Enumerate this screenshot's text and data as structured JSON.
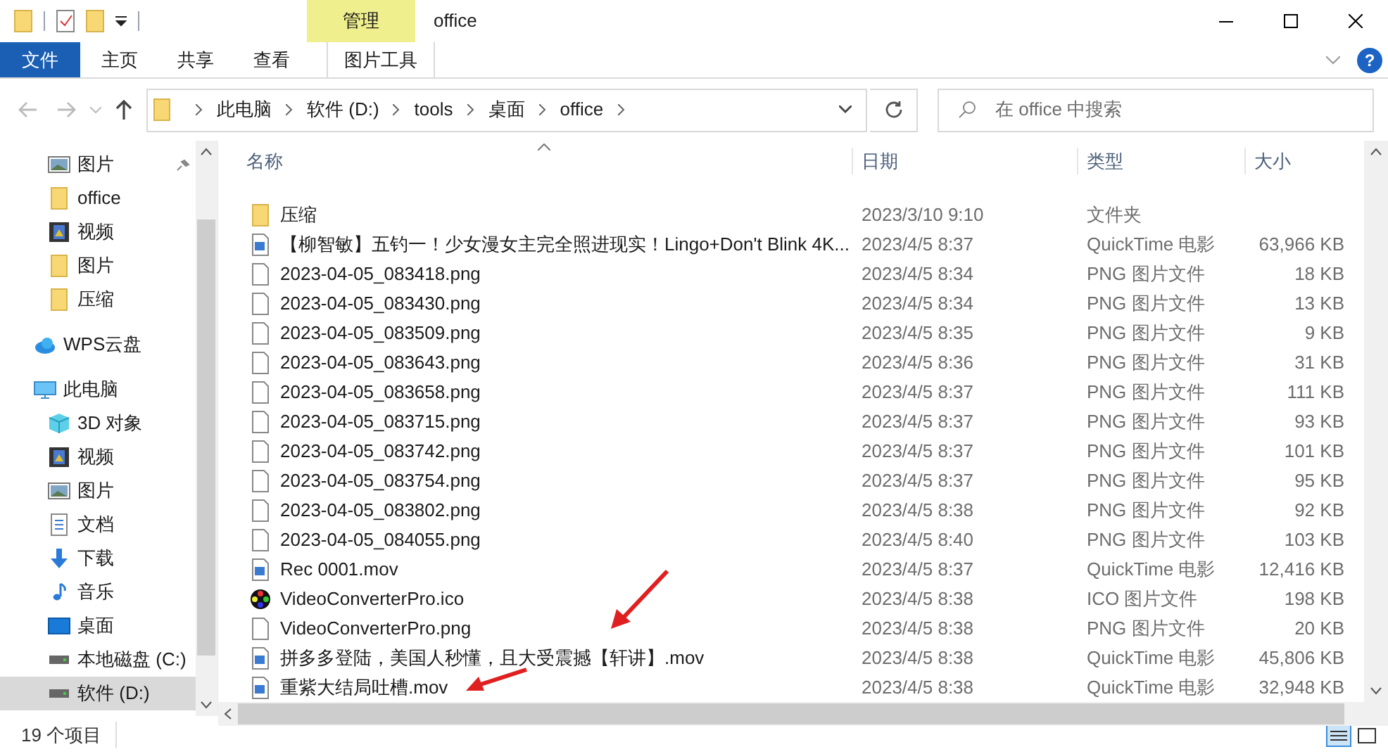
{
  "window": {
    "title": "office",
    "manage_tab": "管理",
    "help": "?"
  },
  "ribbon_tabs": [
    {
      "label": "文件",
      "kind": "file"
    },
    {
      "label": "主页",
      "kind": "tab"
    },
    {
      "label": "共享",
      "kind": "tab"
    },
    {
      "label": "查看",
      "kind": "tab"
    },
    {
      "label": "图片工具",
      "kind": "tool"
    }
  ],
  "breadcrumb": [
    "此电脑",
    "软件 (D:)",
    "tools",
    "桌面",
    "office"
  ],
  "search": {
    "placeholder": "在 office 中搜索"
  },
  "sidebar": {
    "items": [
      {
        "label": "图片",
        "pinned": true,
        "selected": false
      },
      {
        "label": "office",
        "pinned": false,
        "selected": false
      },
      {
        "label": "视频",
        "pinned": false,
        "selected": false
      },
      {
        "label": "图片",
        "pinned": false,
        "selected": false
      },
      {
        "label": "压缩",
        "pinned": false,
        "selected": false
      },
      {
        "label": "WPS云盘",
        "pinned": false,
        "selected": false
      },
      {
        "label": "此电脑",
        "pinned": false,
        "selected": false
      },
      {
        "label": "3D 对象",
        "pinned": false,
        "selected": false
      },
      {
        "label": "视频",
        "pinned": false,
        "selected": false
      },
      {
        "label": "图片",
        "pinned": false,
        "selected": false
      },
      {
        "label": "文档",
        "pinned": false,
        "selected": false
      },
      {
        "label": "下载",
        "pinned": false,
        "selected": false
      },
      {
        "label": "音乐",
        "pinned": false,
        "selected": false
      },
      {
        "label": "桌面",
        "pinned": false,
        "selected": false
      },
      {
        "label": "本地磁盘 (C:)",
        "pinned": false,
        "selected": false
      },
      {
        "label": "软件 (D:)",
        "pinned": false,
        "selected": true
      }
    ]
  },
  "table": {
    "columns": [
      "名称",
      "日期",
      "类型",
      "大小"
    ],
    "rows": [
      {
        "kind": "folder",
        "name": "压缩",
        "date": "2023/3/10 9:10",
        "type": "文件夹"
      },
      {
        "kind": "video",
        "name": "【柳智敏】五钓一！少女漫女主完全照进现实！Lingo+Don't Blink 4K...",
        "date": "2023/4/5 8:37",
        "type": "QuickTime 电影",
        "size": "63,966 KB"
      },
      {
        "kind": "image",
        "name": "2023-04-05_083418.png",
        "date": "2023/4/5 8:34",
        "type": "PNG 图片文件",
        "size": "18 KB"
      },
      {
        "kind": "image",
        "name": "2023-04-05_083430.png",
        "date": "2023/4/5 8:34",
        "type": "PNG 图片文件",
        "size": "13 KB"
      },
      {
        "kind": "image",
        "name": "2023-04-05_083509.png",
        "date": "2023/4/5 8:35",
        "type": "PNG 图片文件",
        "size": "9 KB"
      },
      {
        "kind": "image",
        "name": "2023-04-05_083643.png",
        "date": "2023/4/5 8:36",
        "type": "PNG 图片文件",
        "size": "31 KB"
      },
      {
        "kind": "image",
        "name": "2023-04-05_083658.png",
        "date": "2023/4/5 8:37",
        "type": "PNG 图片文件",
        "size": "111 KB"
      },
      {
        "kind": "image",
        "name": "2023-04-05_083715.png",
        "date": "2023/4/5 8:37",
        "type": "PNG 图片文件",
        "size": "93 KB"
      },
      {
        "kind": "image",
        "name": "2023-04-05_083742.png",
        "date": "2023/4/5 8:37",
        "type": "PNG 图片文件",
        "size": "101 KB"
      },
      {
        "kind": "image",
        "name": "2023-04-05_083754.png",
        "date": "2023/4/5 8:37",
        "type": "PNG 图片文件",
        "size": "95 KB"
      },
      {
        "kind": "image",
        "name": "2023-04-05_083802.png",
        "date": "2023/4/5 8:38",
        "type": "PNG 图片文件",
        "size": "92 KB"
      },
      {
        "kind": "image",
        "name": "2023-04-05_084055.png",
        "date": "2023/4/5 8:40",
        "type": "PNG 图片文件",
        "size": "103 KB"
      },
      {
        "kind": "video",
        "name": "Rec 0001.mov",
        "date": "2023/4/5 8:37",
        "type": "QuickTime 电影",
        "size": "12,416 KB"
      },
      {
        "kind": "ico",
        "name": "VideoConverterPro.ico",
        "date": "2023/4/5 8:38",
        "type": "ICO 图片文件",
        "size": "198 KB"
      },
      {
        "kind": "image",
        "name": "VideoConverterPro.png",
        "date": "2023/4/5 8:38",
        "type": "PNG 图片文件",
        "size": "20 KB"
      },
      {
        "kind": "video",
        "name": "拼多多登陆，美国人秒懂，且大受震撼【轩讲】.mov",
        "date": "2023/4/5 8:38",
        "type": "QuickTime 电影",
        "size": "45,806 KB"
      },
      {
        "kind": "video",
        "name": "重紫大结局吐槽.mov",
        "date": "2023/4/5 8:38",
        "type": "QuickTime 电影",
        "size": "32,948 KB"
      }
    ]
  },
  "status_bar": {
    "count": "19 个项目"
  }
}
